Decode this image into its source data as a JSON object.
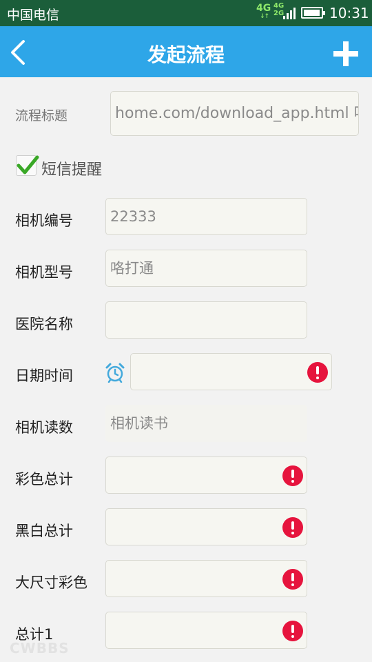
{
  "status_bar": {
    "carrier": "中国电信",
    "network_primary": "4G",
    "network_secondary_top": "4G",
    "network_secondary_bottom": "2G",
    "time": "10:31"
  },
  "header": {
    "title": "发起流程",
    "back_icon": "chevron-left-icon",
    "add_icon": "plus-icon"
  },
  "form": {
    "process_title": {
      "label": "流程标题",
      "value": "home.com/download_app.html 叨"
    },
    "sms_reminder": {
      "label": "短信提醒",
      "checked": true
    },
    "camera_number": {
      "label": "相机编号",
      "value": "22333"
    },
    "camera_model": {
      "label": "相机型号",
      "value": "咯打通"
    },
    "hospital_name": {
      "label": "医院名称",
      "value": ""
    },
    "datetime": {
      "label": "日期时间",
      "value": "",
      "icon": "alarm-clock-icon"
    },
    "camera_reading": {
      "label": "相机读数",
      "placeholder": "相机读书"
    },
    "color_total": {
      "label": "彩色总计",
      "value": ""
    },
    "bw_total": {
      "label": "黑白总计",
      "value": ""
    },
    "large_color": {
      "label": "大尺寸彩色",
      "value": ""
    },
    "total1": {
      "label": "总计1",
      "value": ""
    }
  },
  "watermark": "CWBBS",
  "colors": {
    "status_bar": "#1b5e3a",
    "title_bar": "#2ea6e8",
    "error": "#e6143d",
    "check": "#3aa827"
  }
}
